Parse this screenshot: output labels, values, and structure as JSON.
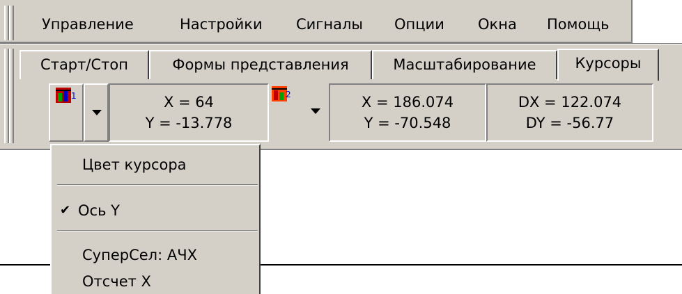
{
  "menu": {
    "items": [
      "Управление",
      "Настройки",
      "Сигналы",
      "Опции",
      "Окна",
      "Помощь"
    ]
  },
  "tabs": {
    "items": [
      "Старт/Стоп",
      "Формы представления",
      "Масштабирование",
      "Курсоры"
    ],
    "active": "Курсоры"
  },
  "cursors": {
    "cursor1": {
      "icon": "cursor-1-color-icon",
      "x": "X = 64",
      "y": "Y = -13.778"
    },
    "cursor2": {
      "icon": "cursor-2-color-icon",
      "x": "X = 186.074",
      "y": "Y = -70.548"
    },
    "delta": {
      "dx": "DX = 122.074",
      "dy": "DY = -56.77"
    }
  },
  "dropdown": {
    "items": [
      {
        "label": "Цвет курсора",
        "checked": false
      },
      {
        "label": "Ось Y",
        "checked": true
      },
      {
        "label": "СуперСел: АЧХ",
        "checked": false
      },
      {
        "label": "Отсчет X",
        "checked": false
      }
    ],
    "check_glyph": "✔"
  },
  "colors": {
    "face": "#d4d0c8",
    "cursor1_icon": [
      "#c00000",
      "#00a000",
      "#0000c0"
    ],
    "cursor2_icon": [
      "#ff4000",
      "#c00000",
      "#00a000"
    ]
  }
}
